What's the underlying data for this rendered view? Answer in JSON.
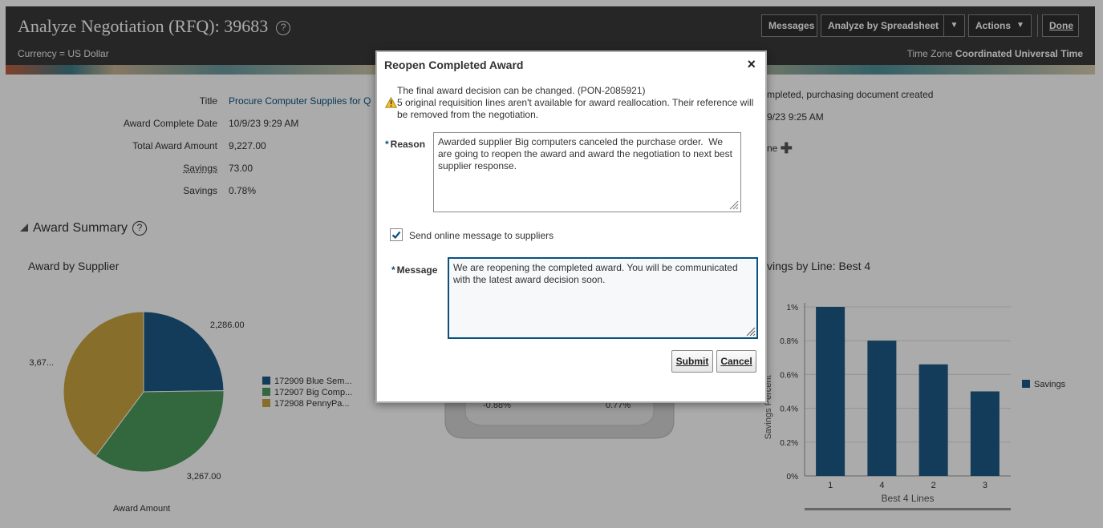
{
  "header": {
    "title": "Analyze Negotiation (RFQ): 39683",
    "help_glyph": "?",
    "currency": "Currency = US Dollar",
    "time_zone_label": "Time Zone",
    "time_zone_value": "Coordinated Universal Time",
    "buttons": {
      "messages": "Messages",
      "analyze_by_spreadsheet": "Analyze by Spreadsheet",
      "actions": "Actions",
      "done": "Done"
    }
  },
  "details": {
    "title_label": "Title",
    "title_value": "Procure Computer Supplies for Q",
    "award_complete_date_label": "Award Complete Date",
    "award_complete_date_value": "10/9/23 9:29 AM",
    "total_award_amount_label": "Total Award Amount",
    "total_award_amount_value": "9,227.00",
    "savings_label": "Savings",
    "savings_value": "73.00",
    "savings_pct_label": "Savings",
    "savings_pct_value": "0.78%",
    "status_value": "mpleted, purchasing document created",
    "date2_value": "9/23 9:25 AM",
    "partial_label": "ne"
  },
  "award_summary": {
    "title": "Award Summary",
    "help_glyph": "?"
  },
  "pie_chart": {
    "title": "Award by Supplier",
    "footer": "Award Amount"
  },
  "gauge": {
    "left_label": "-0.88%",
    "right_label": "0.77%"
  },
  "bar_chart": {
    "title": "vings by Line: Best 4",
    "ylabel": "Savings Percent"
  },
  "chart_data": [
    {
      "type": "pie",
      "title": "Award by Supplier",
      "labels": [
        "172909 Blue Sem...",
        "172907 Big Comp...",
        "172908 PennyPa..."
      ],
      "values": [
        2286,
        3267,
        3674
      ],
      "value_labels": [
        "2,286.00",
        "3,267.00",
        "3,67..."
      ],
      "colors": [
        "#1c5a85",
        "#4d9a5c",
        "#c9a640"
      ],
      "legend_position": "right"
    },
    {
      "type": "bar",
      "title": "vings by Line: Best 4",
      "categories": [
        "1",
        "4",
        "2",
        "3"
      ],
      "series": [
        {
          "name": "Savings",
          "values": [
            1.0,
            0.8,
            0.66,
            0.5
          ]
        }
      ],
      "xlabel": "Best 4 Lines",
      "ylabel": "Savings Percent",
      "yticks": [
        "0%",
        "0.2%",
        "0.4%",
        "0.6%",
        "0.8%",
        "1%"
      ],
      "ylim": [
        0,
        1.0
      ],
      "color": "#1c5a85",
      "legend_position": "right"
    }
  ],
  "dialog": {
    "title": "Reopen Completed Award",
    "close_glyph": "×",
    "info_line": "The final award decision can be changed. (PON-2085921)",
    "warning_line": "5 original requisition lines aren't available for award reallocation. Their reference will be removed from the negotiation.",
    "reason_label": "Reason",
    "reason_value": "Awarded supplier Big computers canceled the purchase order.  We are going to reopen the award and award the negotiation to next best supplier response.",
    "send_message_label": "Send online message to suppliers",
    "send_message_checked": true,
    "message_label": "Message",
    "message_value": "We are reopening the completed award. You will be communicated with the latest award decision soon.",
    "submit": "Submit",
    "cancel": "Cancel",
    "required_glyph": "*"
  }
}
